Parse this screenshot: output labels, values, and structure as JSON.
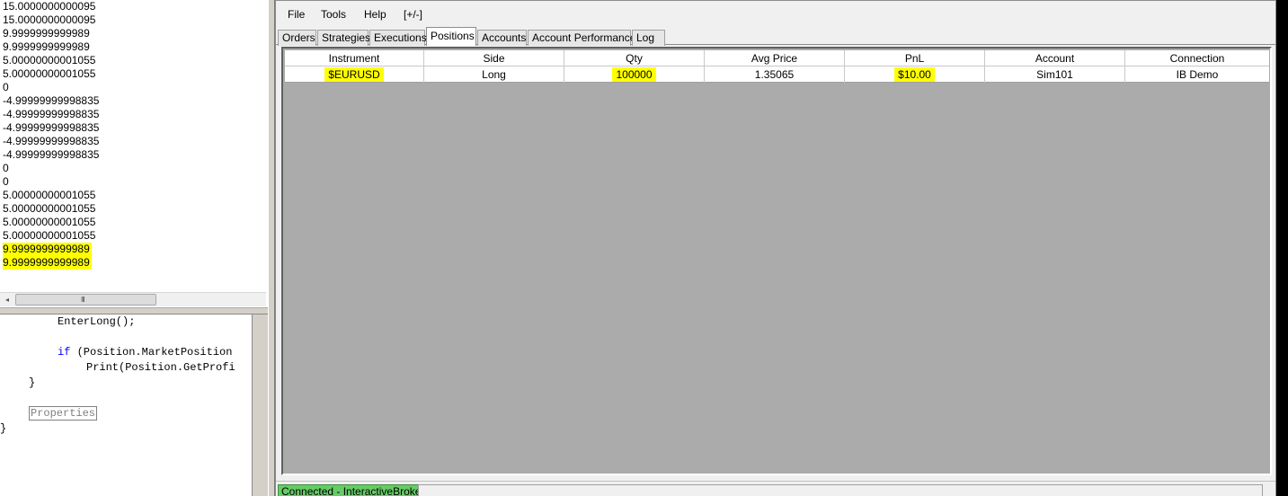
{
  "output": {
    "lines": [
      {
        "text": "15.0000000000095",
        "highlight": false
      },
      {
        "text": "15.0000000000095",
        "highlight": false
      },
      {
        "text": "9.9999999999989",
        "highlight": false
      },
      {
        "text": "9.9999999999989",
        "highlight": false
      },
      {
        "text": "5.00000000001055",
        "highlight": false
      },
      {
        "text": "5.00000000001055",
        "highlight": false
      },
      {
        "text": "0",
        "highlight": false
      },
      {
        "text": "-4.99999999998835",
        "highlight": false
      },
      {
        "text": "-4.99999999998835",
        "highlight": false
      },
      {
        "text": "-4.99999999998835",
        "highlight": false
      },
      {
        "text": "-4.99999999998835",
        "highlight": false
      },
      {
        "text": "-4.99999999998835",
        "highlight": false
      },
      {
        "text": "0",
        "highlight": false
      },
      {
        "text": "0",
        "highlight": false
      },
      {
        "text": "5.00000000001055",
        "highlight": false
      },
      {
        "text": "5.00000000001055",
        "highlight": false
      },
      {
        "text": "5.00000000001055",
        "highlight": false
      },
      {
        "text": "5.00000000001055",
        "highlight": false
      },
      {
        "text": "9.9999999999989",
        "highlight": true
      },
      {
        "text": "9.9999999999989",
        "highlight": true
      }
    ],
    "scroll_left_glyph": "◂",
    "scroll_grip": "III"
  },
  "code": {
    "line1": "EnterLong();",
    "line2_kw": "if",
    "line2_rest": " (Position.MarketPosition",
    "line3": "Print(Position.GetProfi",
    "line4": "}",
    "collapsed": "Properties",
    "line6": "}"
  },
  "menu": {
    "file": "File",
    "tools": "Tools",
    "help": "Help",
    "toggle": "[+/-]"
  },
  "tabs": [
    "Orders",
    "Strategies",
    "Executions",
    "Positions",
    "Accounts",
    "Account Performance",
    "Log"
  ],
  "active_tab": "Positions",
  "grid": {
    "headers": [
      "Instrument",
      "Side",
      "Qty",
      "Avg Price",
      "PnL",
      "Account",
      "Connection"
    ],
    "row": {
      "instrument": "$EURUSD",
      "side": "Long",
      "qty": "100000",
      "avg_price": "1.35065",
      "pnl": "$10.00",
      "account": "Sim101",
      "connection": "IB Demo"
    }
  },
  "status": {
    "connection": "Connected - InteractiveBrokers"
  },
  "colors": {
    "highlight": "#ffff00",
    "connected": "#66cc66",
    "grid_background": "#ababab",
    "keyword": "#0000ff"
  }
}
